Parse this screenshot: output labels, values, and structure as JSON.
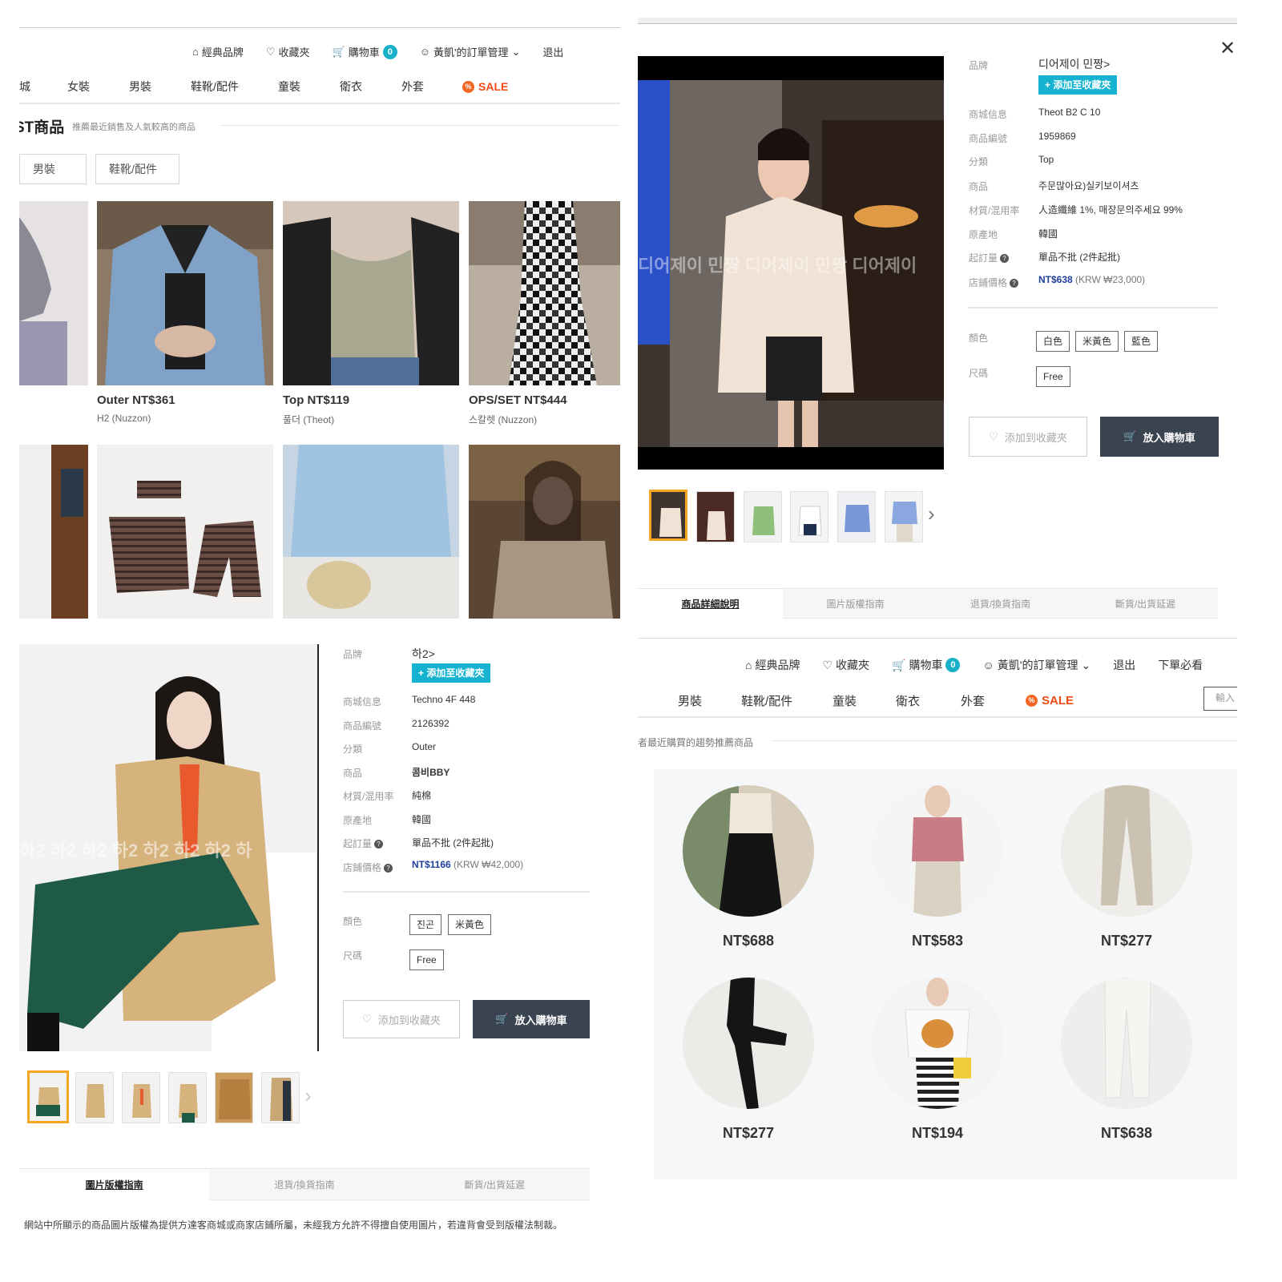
{
  "q1": {
    "util": {
      "brand": "經典品牌",
      "favorites": "收藏夾",
      "cart": "購物車",
      "cart_count": "0",
      "orders": "黃凱'的訂單管理",
      "logout": "退出"
    },
    "nav": {
      "partial": "城",
      "women": "女裝",
      "men": "男裝",
      "shoes": "鞋靴/配件",
      "kids": "童裝",
      "hoodie": "衛衣",
      "outer": "外套",
      "sale": "SALE"
    },
    "best": {
      "title": "ST商品",
      "subtitle": "推薦最近銷售及人氣較高的商品"
    },
    "filters": [
      "男裝",
      "鞋靴/配件"
    ],
    "products": [
      {
        "name": "Outer NT$361",
        "brand": "H2 (Nuzzon)"
      },
      {
        "name": "Top NT$119",
        "brand": "풀더 (Theot)"
      },
      {
        "name": "OPS/SET NT$444",
        "brand": "스칼렛 (Nuzzon)"
      }
    ]
  },
  "q2": {
    "watermark": "디어제이 민짱   디어제이 민짱   디어제이",
    "labels": {
      "brand": "品牌",
      "mall": "商城信息",
      "code": "商品編號",
      "cat": "分類",
      "product": "商品",
      "material": "材質/混用率",
      "origin": "原產地",
      "moq": "起訂量",
      "price": "店鋪價格",
      "color": "顏色",
      "size": "尺碼"
    },
    "brand": "디어제이 민짱>",
    "add_fav": "+ 添加至收藏夾",
    "mall": "Theot B2 C 10",
    "code": "1959869",
    "category": "Top",
    "product": "주문많아요)실키보이셔츠",
    "material": "人造纖維 1%, 매장문의주세요 99%",
    "origin": "韓國",
    "moq": "單品不批 (2件起批)",
    "price": "NT$638",
    "krw": "(KRW ₩23,000)",
    "colors": [
      "白色",
      "米黃色",
      "藍色"
    ],
    "sizes": [
      "Free"
    ],
    "btn_fav": "添加到收藏夾",
    "btn_cart": "放入購物車",
    "tabs": [
      "商品詳細說明",
      "圖片版權指南",
      "退貨/換貨指南",
      "斷貨/出貨延遲"
    ]
  },
  "q3": {
    "watermark": "하2  하2  하2  하2  하2  하2  하2  하",
    "brand": "하2>",
    "add_fav": "+ 添加至收藏夾",
    "mall": "Techno 4F 448",
    "code": "2126392",
    "category": "Outer",
    "product": "콤비BBY",
    "material": "純棉",
    "origin": "韓國",
    "moq": "單品不批 (2件起批)",
    "price": "NT$1166",
    "krw": "(KRW ₩42,000)",
    "colors": [
      "진곤",
      "米黃色"
    ],
    "sizes": [
      "Free"
    ],
    "btn_fav": "添加到收藏夾",
    "btn_cart": "放入購物車",
    "tabs": [
      "圖片版權指南",
      "退貨/換貨指南",
      "斷貨/出貨延遲"
    ],
    "notice": "網站中所顯示的商品圖片版權為提供方達客商城或商家店鋪所屬，未經我方允許不得擅自使用圖片，若違背會受到版權法制裁。"
  },
  "q4": {
    "util": {
      "brand": "經典品牌",
      "favorites": "收藏夾",
      "cart": "購物車",
      "cart_count": "0",
      "orders": "黃凱'的訂單管理",
      "logout": "退出",
      "guide": "下單必看"
    },
    "nav": {
      "men": "男裝",
      "shoes": "鞋靴/配件",
      "kids": "童裝",
      "hoodie": "衛衣",
      "outer": "外套",
      "sale": "SALE"
    },
    "search_placeholder": "輸入",
    "section_sub": "者最近購買的趨勢推薦商品",
    "prices": [
      "NT$688",
      "NT$583",
      "NT$277",
      "NT$277",
      "NT$194",
      "NT$638"
    ]
  },
  "colors": {
    "accent": "#16b3d1",
    "sale": "#f04a16",
    "price": "#1f3f9f",
    "dark_button": "#3a4350"
  }
}
